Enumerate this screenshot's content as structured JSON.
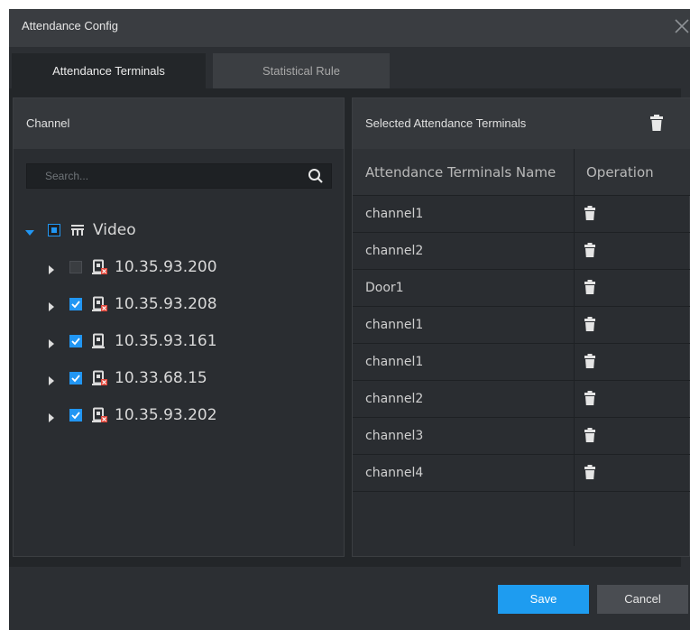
{
  "window": {
    "title": "Attendance Config"
  },
  "tabs": [
    {
      "label": "Attendance Terminals",
      "active": true
    },
    {
      "label": "Statistical Rule",
      "active": false
    }
  ],
  "left_panel": {
    "header": "Channel",
    "search_placeholder": "Search...",
    "tree": {
      "root": {
        "label": "Video",
        "expanded": true,
        "checkbox": "partial",
        "icon": "video-group-icon"
      },
      "children": [
        {
          "label": "10.35.93.200",
          "checked": false,
          "icon": "device-offline-icon"
        },
        {
          "label": "10.35.93.208",
          "checked": true,
          "icon": "device-offline-icon"
        },
        {
          "label": "10.35.93.161",
          "checked": true,
          "icon": "device-online-icon"
        },
        {
          "label": "10.33.68.15",
          "checked": true,
          "icon": "device-offline-icon"
        },
        {
          "label": "10.35.93.202",
          "checked": true,
          "icon": "device-offline-icon"
        }
      ]
    }
  },
  "right_panel": {
    "header": "Selected Attendance Terminals",
    "columns": [
      "Attendance Terminals Name",
      "Operation"
    ],
    "rows": [
      {
        "name": "channel1"
      },
      {
        "name": "channel2"
      },
      {
        "name": "Door1"
      },
      {
        "name": "channel1"
      },
      {
        "name": "channel1"
      },
      {
        "name": "channel2"
      },
      {
        "name": "channel3"
      },
      {
        "name": "channel4"
      }
    ]
  },
  "footer": {
    "save_label": "Save",
    "cancel_label": "Cancel"
  },
  "colors": {
    "accent": "#1e9cf0",
    "checkbox": "#2196f3",
    "dialog_bg": "#2c2f33",
    "panel_bg": "#2a2d31",
    "device_badge": "#e0463a"
  }
}
